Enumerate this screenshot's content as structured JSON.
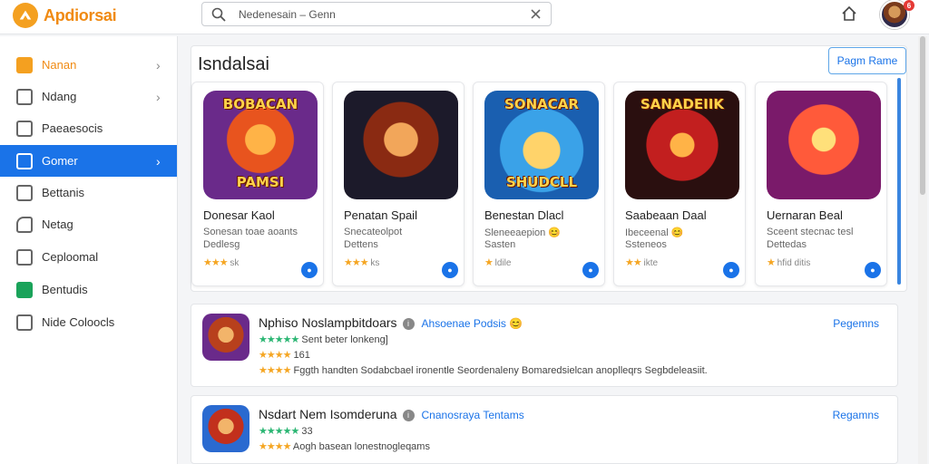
{
  "app": {
    "brand": "Apdiorsai"
  },
  "search": {
    "text": "Nedenesain  –  Genn"
  },
  "notifications": {
    "count": "6"
  },
  "sidebar": {
    "items": [
      {
        "label": "Nanan",
        "icon": "apps-icon",
        "has_chevron": true,
        "state": "orange"
      },
      {
        "label": "Ndang",
        "icon": "window-icon",
        "has_chevron": true,
        "state": "normal"
      },
      {
        "label": "Paeaesocis",
        "icon": "grid-icon",
        "has_chevron": false,
        "state": "normal"
      },
      {
        "label": "Gomer",
        "icon": "card-icon",
        "has_chevron": true,
        "state": "active"
      },
      {
        "label": "Bettanis",
        "icon": "folder-icon",
        "has_chevron": false,
        "state": "normal"
      },
      {
        "label": "Netag",
        "icon": "tag-icon",
        "has_chevron": false,
        "state": "normal"
      },
      {
        "label": "Ceploomal",
        "icon": "check-icon",
        "has_chevron": false,
        "state": "normal"
      },
      {
        "label": "Bentudis",
        "icon": "green-square-icon",
        "has_chevron": false,
        "state": "normal"
      },
      {
        "label": "Nide Coloocls",
        "icon": "checkbox-icon",
        "has_chevron": false,
        "state": "normal"
      }
    ]
  },
  "featured": {
    "title": "Isndalsai",
    "button": "Pagm  Rame",
    "cards": [
      {
        "art_text_top": "BOBACAN",
        "art_text_bottom": "PAMSI",
        "title": "Donesar Kaol",
        "sub1": "Sonesan toae aoants",
        "sub2": "Dedlesg",
        "stars": "★★★",
        "rating_text": "sk"
      },
      {
        "art_text_top": "",
        "art_text_bottom": "",
        "title": "Penatan  Spail",
        "sub1": "Snecateolpot",
        "sub2": "Dettens",
        "stars": "★★★",
        "rating_text": "ks"
      },
      {
        "art_text_top": "SONACAR",
        "art_text_bottom": "SHUDCLL",
        "title": "Benestan  Dlacl",
        "sub1": "Sleneeaepion 😊",
        "sub2": "Sasten",
        "stars": "★",
        "rating_text": "ldile"
      },
      {
        "art_text_top": "SANADEIIK",
        "art_text_bottom": "",
        "title": "Saabeaan  Daal",
        "sub1": "Ibeceenal 😊",
        "sub2": "Ssteneos",
        "stars": "★★",
        "rating_text": "ikte"
      },
      {
        "art_text_top": "",
        "art_text_bottom": "",
        "title": "Uernaran  Beal",
        "sub1": "Sceent stecnac tesl",
        "sub2": "Dettedas",
        "stars": "★",
        "rating_text": "hfid ditis"
      }
    ]
  },
  "list": [
    {
      "title": "Nphiso Noslampbitdoars",
      "developer": "Ahsoenae Podsis 😊",
      "link": "Pegemns",
      "line1_stars": "★★★★★",
      "line1_text": "Sent beter lonkeng]",
      "line2_stars": "★★★★",
      "line2_text": "161",
      "line3_stars": "★★★★",
      "line3_text": "Fggth handten Sodabcbael ironentle Seordenaleny Bomaredsielcan anoplleqrs Segbdeleasiit."
    },
    {
      "title": "Nsdart Nem Isomderuna",
      "developer": "Cnanosraya Tentams",
      "link": "Regamns",
      "line1_stars": "★★★★★",
      "line1_text": "33",
      "line2_stars": "★★★★",
      "line2_text": "Aogh basean lonestnogleqams",
      "line3_stars": "",
      "line3_text": ""
    }
  ]
}
